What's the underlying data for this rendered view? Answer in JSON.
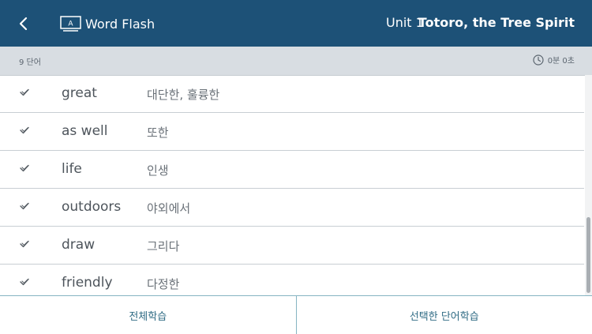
{
  "header": {
    "app_title": "Word Flash",
    "unit_label": "Unit 1",
    "unit_title": "Totoro, the Tree Spirit"
  },
  "subbar": {
    "word_count": "9 단어",
    "timer": "0분 0초"
  },
  "words": [
    {
      "en": "great",
      "ko": "대단한, 훌륭한"
    },
    {
      "en": "as well",
      "ko": "또한"
    },
    {
      "en": "life",
      "ko": "인생"
    },
    {
      "en": "outdoors",
      "ko": "야외에서"
    },
    {
      "en": "draw",
      "ko": "그리다"
    },
    {
      "en": "friendly",
      "ko": "다정한"
    }
  ],
  "bottom": {
    "study_all": "전체학습",
    "study_selected": "선택한 단어학습"
  },
  "colors": {
    "header_bg": "#1d5177",
    "subbar_bg": "#d8dde2",
    "accent_text": "#2f6b84"
  },
  "icons": {
    "back": "chevron-left-icon",
    "app": "flashcard-icon",
    "timer": "clock-icon",
    "check": "checkmark-icon"
  }
}
